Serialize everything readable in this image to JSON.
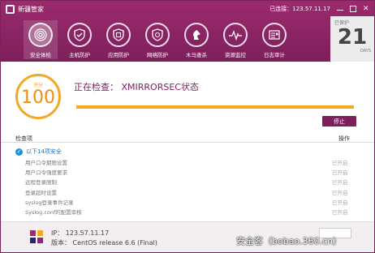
{
  "app": {
    "title": "新疆管家"
  },
  "header": {
    "ip_label": "已连接：123.57.11.17"
  },
  "nav": [
    {
      "label": "安全体检",
      "icon": "fingerprint-icon",
      "active": true
    },
    {
      "label": "主机防护",
      "icon": "shield-icon"
    },
    {
      "label": "应用防护",
      "icon": "shield-check-icon"
    },
    {
      "label": "网络防护",
      "icon": "shield-network-icon"
    },
    {
      "label": "木马查杀",
      "icon": "horse-icon"
    },
    {
      "label": "资源监控",
      "icon": "pulse-icon"
    },
    {
      "label": "日志审计",
      "icon": "log-icon"
    }
  ],
  "days": {
    "label": "已保护",
    "value": "21",
    "unit": "DAYS"
  },
  "scan": {
    "score_label": "评分",
    "score": "100",
    "status": "正在检查：  XMIRRORSEC状态",
    "progress_percent": 100,
    "stop_label": "停止"
  },
  "list": {
    "col_item": "检查项",
    "col_action": "操作",
    "group_label": "以下14项安全",
    "rows": [
      {
        "name": "用户口令期限设置",
        "status": "已开启"
      },
      {
        "name": "用户口令强度要求",
        "status": "已开启"
      },
      {
        "name": "远程登录限制",
        "status": "已开启"
      },
      {
        "name": "登录超时设置",
        "status": "已开启"
      },
      {
        "name": "syslog登录事件记录",
        "status": "已开启"
      },
      {
        "name": "Syslog.conf的配置审核",
        "status": "已开启"
      }
    ]
  },
  "footer": {
    "ip": "IP：   123.57.11.17",
    "version": "版本：  CentOS release 6.6 (Final)"
  },
  "watermark": "安全客（bobao.360.cn）",
  "colors": {
    "brand": "#7d1f5a",
    "accent": "#f5a623",
    "link": "#1e73be"
  }
}
